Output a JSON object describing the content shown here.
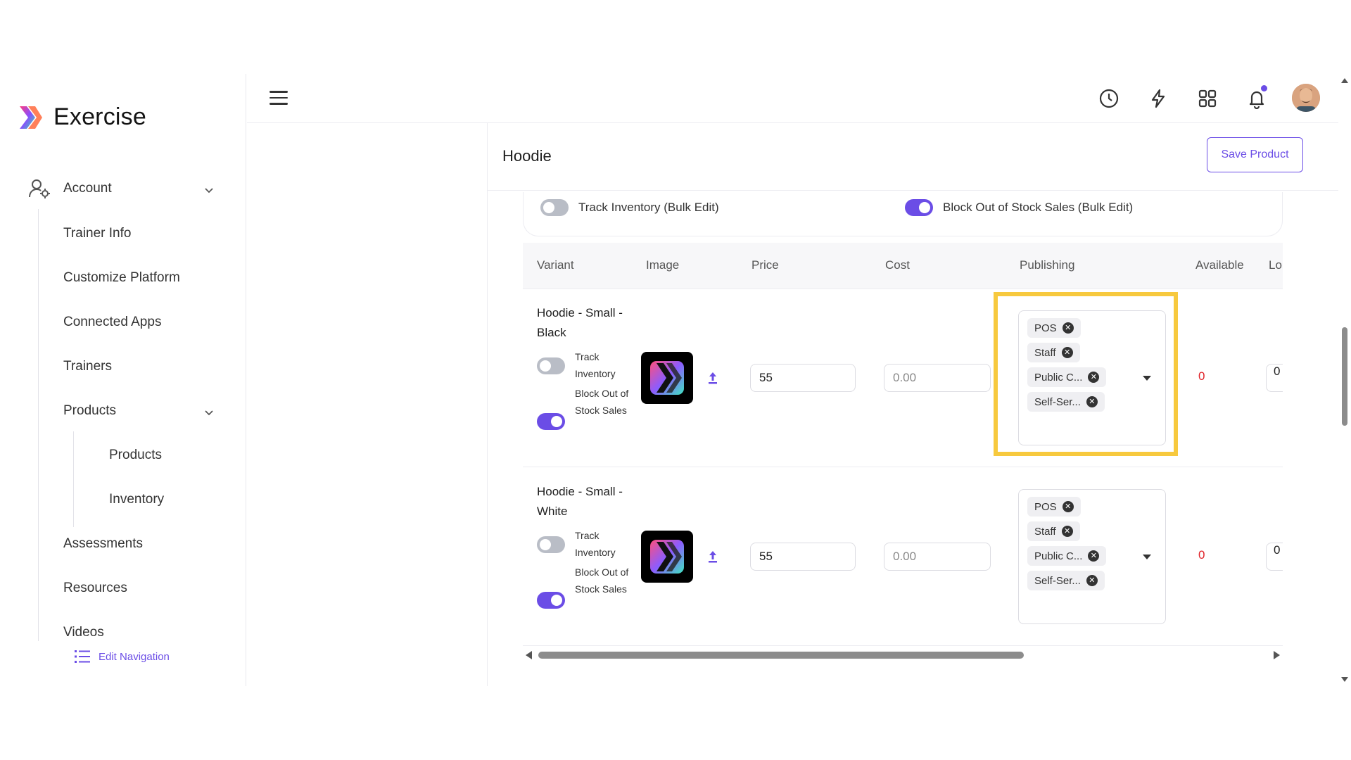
{
  "brand": {
    "name": "Exercise"
  },
  "sidebar": {
    "account": "Account",
    "items": [
      "Trainer Info",
      "Customize Platform",
      "Connected Apps",
      "Trainers"
    ],
    "products": "Products",
    "products_sub": [
      "Products",
      "Inventory"
    ],
    "items_after": [
      "Assessments",
      "Resources",
      "Videos"
    ],
    "edit_navigation": "Edit Navigation"
  },
  "topbar": {
    "icons": [
      "history-icon",
      "bolt-icon",
      "apps-grid-icon",
      "bell-icon"
    ],
    "accent_color": "#6b4de6"
  },
  "product": {
    "title": "Hoodie",
    "save_label": "Save Product",
    "bulk": {
      "track_inventory": "Track Inventory (Bulk Edit)",
      "track_inventory_on": false,
      "block_sales": "Block Out of Stock Sales (Bulk Edit)",
      "block_sales_on": true
    }
  },
  "table": {
    "columns": [
      "Variant",
      "Image",
      "Price",
      "Cost",
      "Publishing",
      "Available",
      "Lo"
    ],
    "rows": [
      {
        "variant": "Hoodie - Small - Black",
        "track_label": "Track Inventory",
        "track_on": false,
        "block_label": "Block Out of Stock Sales",
        "block_on": true,
        "price": "55",
        "cost_placeholder": "0.00",
        "publishing": [
          "POS",
          "Staff",
          "Public C...",
          "Self-Ser..."
        ],
        "available": "0",
        "lo": "0"
      },
      {
        "variant": "Hoodie - Small - White",
        "track_label": "Track Inventory",
        "track_on": false,
        "block_label": "Block Out of Stock Sales",
        "block_on": true,
        "price": "55",
        "cost_placeholder": "0.00",
        "publishing": [
          "POS",
          "Staff",
          "Public C...",
          "Self-Ser..."
        ],
        "available": "0",
        "lo": "0"
      }
    ]
  },
  "highlight_color": "#f7c93e"
}
